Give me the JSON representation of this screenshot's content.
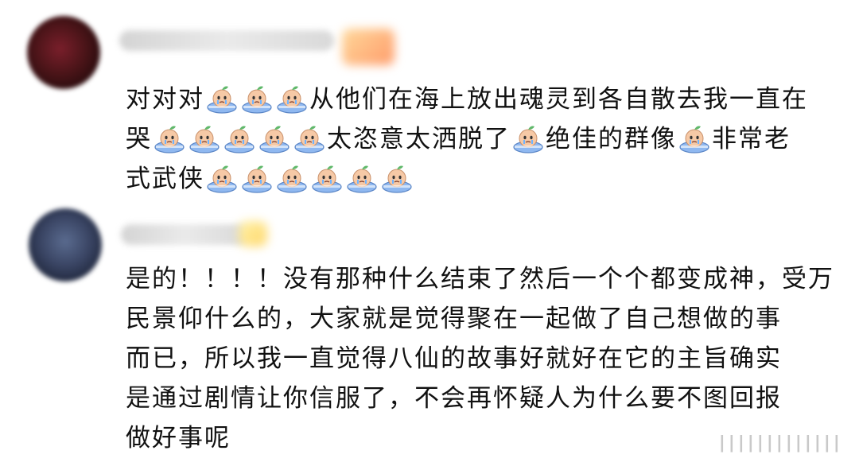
{
  "comments": [
    {
      "lines": [
        [
          "对对对",
          "crying-icon",
          "crying-icon",
          "crying-icon",
          "从他们在海上放出魂灵到各自散去我一直在"
        ],
        [
          "哭",
          "crying-icon",
          "crying-icon",
          "crying-icon",
          "crying-icon",
          "crying-icon",
          "太恣意太洒脱了",
          "crying-icon",
          "绝佳的群像",
          "crying-icon",
          "非常老"
        ],
        [
          "式武侠",
          "crying-icon",
          "crying-icon",
          "crying-icon",
          "crying-icon",
          "crying-icon",
          "crying-icon"
        ]
      ]
    },
    {
      "lines": [
        [
          "是的！！！！没有那种什么结束了然后一个个都变成神，受万"
        ],
        [
          "民景仰什么的，大家就是觉得聚在一起做了自己想做的事"
        ],
        [
          "而已，所以我一直觉得八仙的故事好就好在它的主旨确实"
        ],
        [
          "是通过剧情让你信服了，不会再怀疑人为什么要不图回报"
        ],
        [
          "做好事呢"
        ]
      ]
    }
  ],
  "watermark": "∣∣∣∣∣∣∣∣∣∣∣∣∣",
  "colors": {
    "text": "#111111",
    "emoji_face": "#f6c9a6",
    "emoji_tub": "#8fb8f0",
    "emoji_leaf": "#5fb86a"
  }
}
